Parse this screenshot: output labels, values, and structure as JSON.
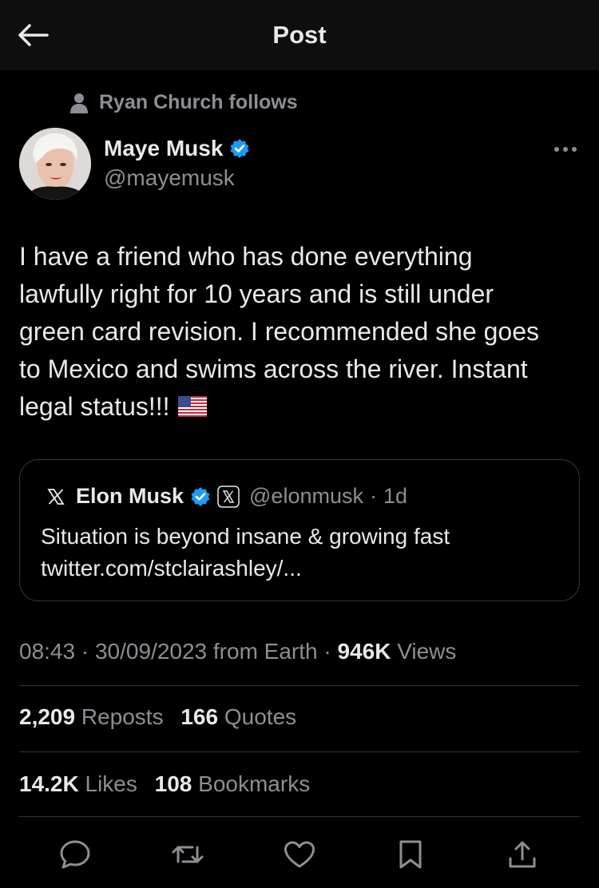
{
  "header": {
    "title": "Post",
    "back_icon": "arrow-left-icon"
  },
  "social_context": {
    "icon": "person-icon",
    "text": "Ryan Church follows"
  },
  "author": {
    "name": "Maye Musk",
    "handle": "@mayemusk",
    "verified_color": "#1d9bf0"
  },
  "tweet": {
    "text_lines": [
      "I have a friend who has done everything",
      "lawfully right for 10 years and is still under",
      "green card revision. I recommended she goes",
      "to Mexico and swims across the river. Instant",
      "legal status!!!"
    ],
    "emoji": "flag-us-icon"
  },
  "quote": {
    "x_logo": "x-logo-icon",
    "name": "Elon Musk",
    "affiliate_badge": "x-affiliate-badge-icon",
    "handle": "@elonmusk",
    "separator": "·",
    "time": "1d",
    "text_lines": [
      "Situation is beyond  insane & growing fast",
      "twitter.com/stclairashley/..."
    ]
  },
  "meta": {
    "time": "08:43",
    "sep1": " · ",
    "date": "30/09/2023",
    "source": " from Earth",
    "sep2": " · ",
    "views_count": "946K",
    "views_label": " Views"
  },
  "stats": {
    "reposts": "2,209",
    "reposts_label": "Reposts",
    "quotes": "166",
    "quotes_label": "Quotes",
    "likes": "14.2K",
    "likes_label": "Likes",
    "bookmarks": "108",
    "bookmarks_label": "Bookmarks"
  },
  "actions": [
    "reply-icon",
    "repost-icon",
    "like-icon",
    "bookmark-icon",
    "share-icon"
  ],
  "colors": {
    "background": "#000000",
    "text": "#e7e9ea",
    "secondary": "#8b8f94",
    "border": "#2f3336",
    "accent": "#1d9bf0"
  }
}
